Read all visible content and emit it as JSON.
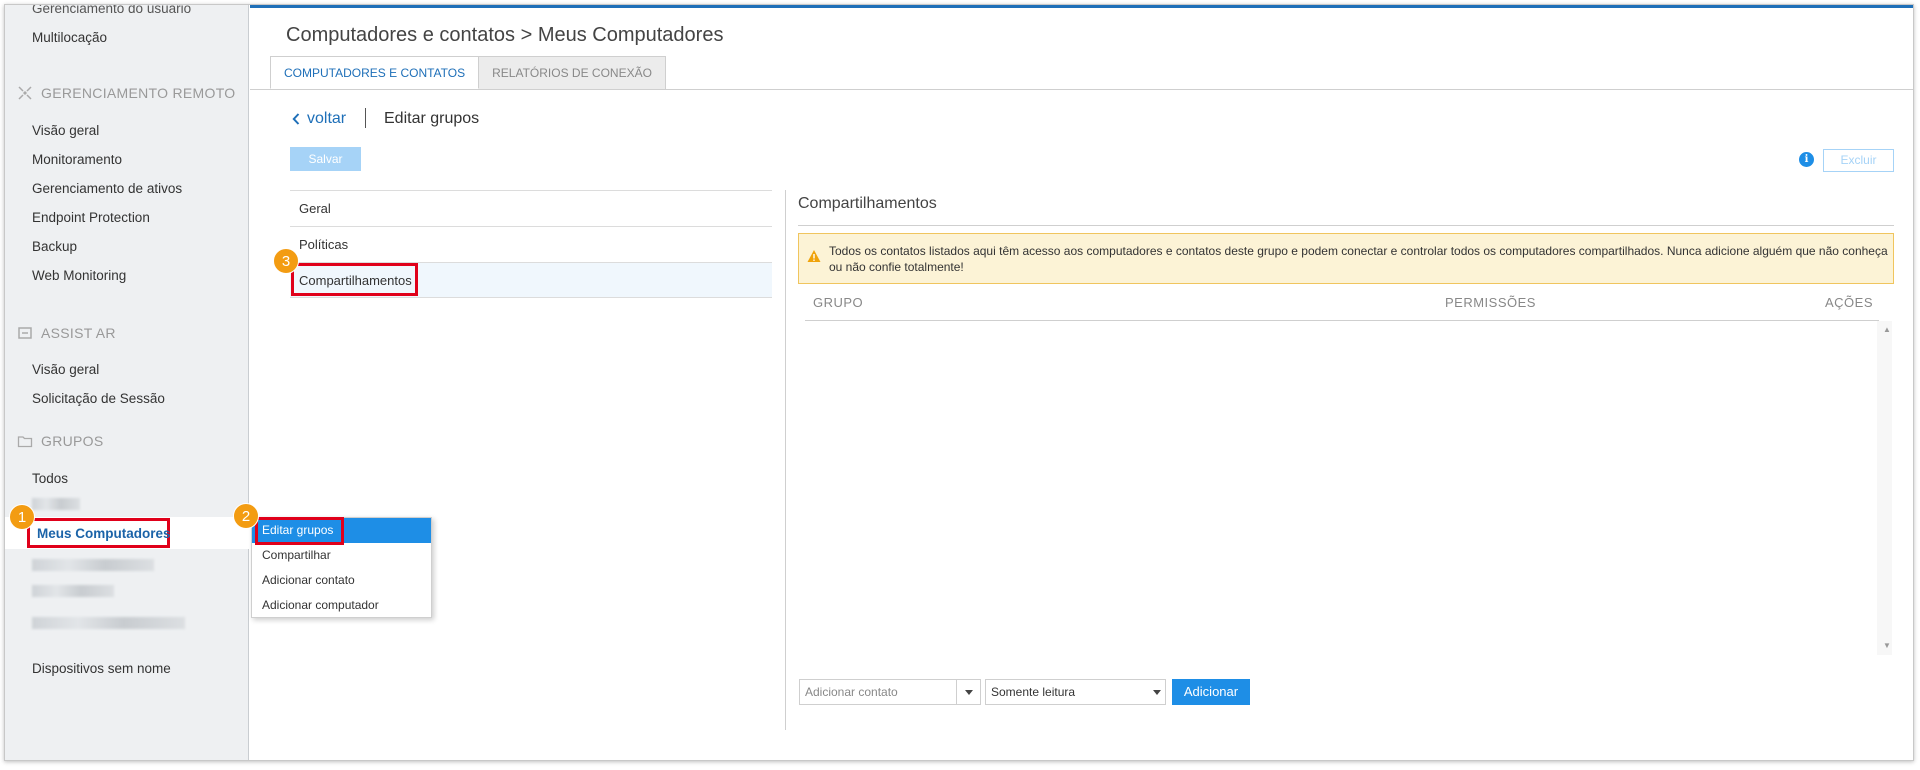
{
  "sidebar": {
    "top_items": [
      "Gerenciamento do usuário",
      "Multilocação"
    ],
    "remote": {
      "header": "GERENCIAMENTO REMOTO",
      "items": [
        "Visão geral",
        "Monitoramento",
        "Gerenciamento de ativos",
        "Endpoint Protection",
        "Backup",
        "Web Monitoring"
      ]
    },
    "assist": {
      "header": "ASSIST AR",
      "items": [
        "Visão geral",
        "Solicitação de Sessão"
      ]
    },
    "groups": {
      "header": "GRUPOS",
      "all": "Todos",
      "active": "Meus Computadores",
      "unnamed": "Dispositivos sem nome"
    }
  },
  "badges": {
    "one": "1",
    "two": "2",
    "three": "3"
  },
  "context_menu": [
    "Editar grupos",
    "Compartilhar",
    "Adicionar contato",
    "Adicionar computador"
  ],
  "main": {
    "title": "Computadores e contatos > Meus Computadores",
    "tabs": [
      "COMPUTADORES E CONTATOS",
      "RELATÓRIOS DE CONEXÃO"
    ],
    "back": "voltar",
    "edit_title": "Editar grupos",
    "save": "Salvar",
    "delete": "Excluir",
    "info": "i",
    "left_menu": [
      "Geral",
      "Políticas",
      "Compartilhamentos"
    ],
    "shares_title": "Compartilhamentos",
    "warning": "Todos os contatos listados aqui têm acesso aos computadores e contatos deste grupo e podem conectar e controlar todos os computadores compartilhados. Nunca adicione alguém que não conheça ou não confie totalmente!",
    "table_headers": {
      "group": "GRUPO",
      "permissions": "PERMISSÕES",
      "actions": "AÇÕES"
    },
    "add_contact_placeholder": "Adicionar contato",
    "permission_value": "Somente leitura",
    "add_button": "Adicionar"
  },
  "colors": {
    "accent": "#1e8ee6",
    "highlight": "#e0001a",
    "badge": "#f39c12",
    "warning_bg": "#fcf3d6"
  }
}
